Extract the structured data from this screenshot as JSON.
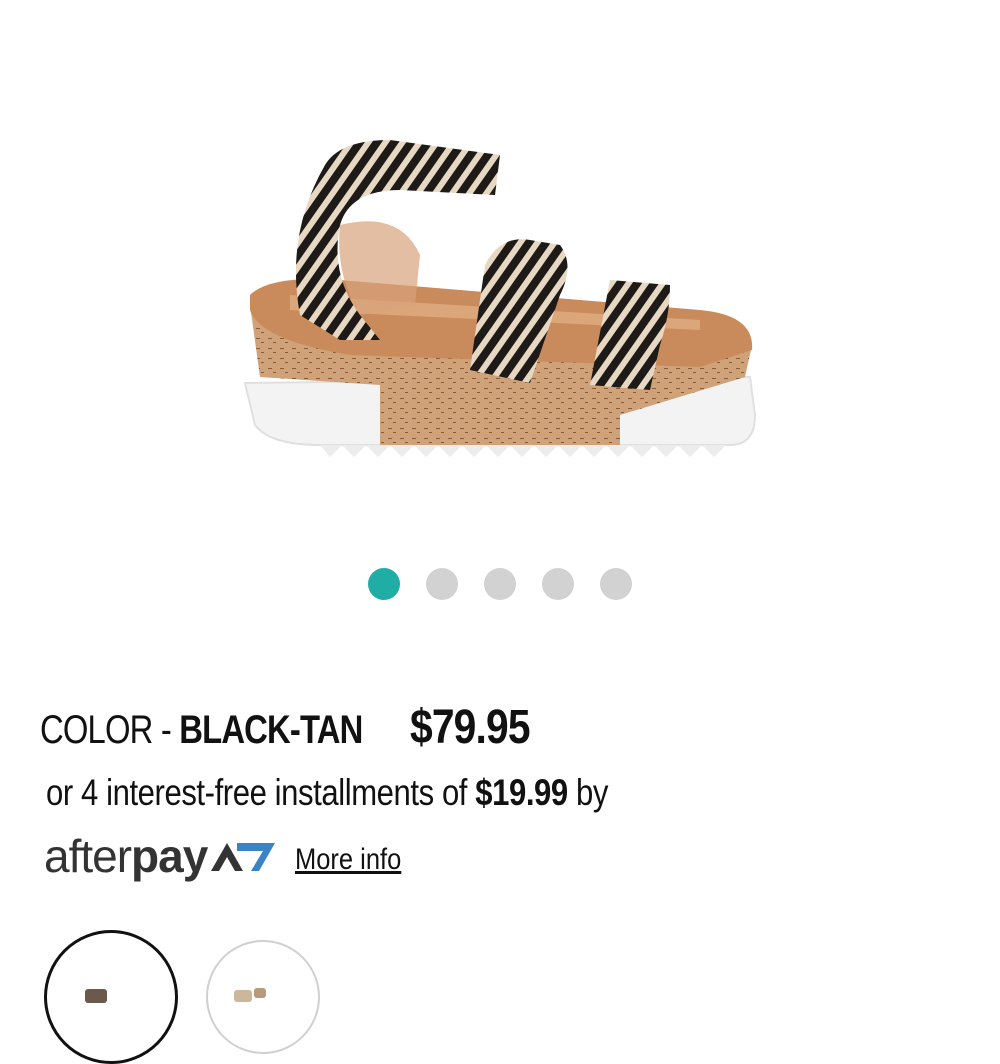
{
  "product": {
    "image_alt": "black-tan platform sandal",
    "color_prefix": "COLOR - ",
    "color_value": "BLACK-TAN",
    "price": "$79.95"
  },
  "carousel": {
    "active_index": 0,
    "total": 5
  },
  "installments": {
    "prefix": "or 4 interest-free installments of ",
    "amount": "$19.99",
    "suffix": " by"
  },
  "afterpay": {
    "logo_light": "after",
    "logo_bold": "pay",
    "more_info": "More info"
  },
  "swatches": {
    "selected_index": 0,
    "count": 2
  },
  "colors": {
    "accent": "#1fada6",
    "dot_inactive": "#d2d2d2",
    "afterpay_arrow": "#3a83c4"
  }
}
